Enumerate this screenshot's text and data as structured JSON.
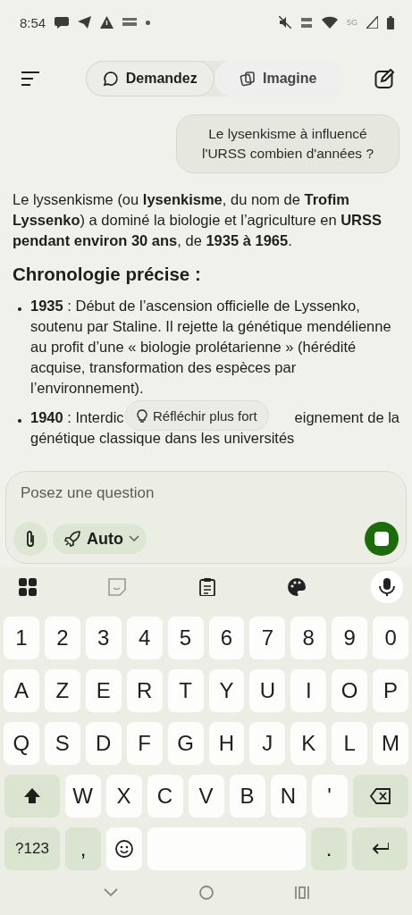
{
  "status_bar": {
    "time": "8:54",
    "network": "5G"
  },
  "header": {
    "tabs": [
      {
        "label": "Demandez",
        "selected": true
      },
      {
        "label": "Imagine",
        "selected": false
      }
    ]
  },
  "user_message": "Le lysenkisme à influencé l'URSS combien d'années ?",
  "answer": {
    "intro": "Le lyssenkisme (ou **lysenkisme**, du nom de **Trofim Lyssenko**) a dominé la biologie et l’agriculture en **URSS pendant environ 30 ans**, de **1935 à 1965**.",
    "heading": "Chronologie précise :",
    "bullets": [
      {
        "text": "**1935** : Début de l’ascension officielle de Lyssenko, soutenu par Staline. Il rejette la génétique mendélienne au profit d’une « biologie prolétarienne » (hérédité acquise, transformation des espèces par l’environnement)."
      },
      {
        "before": "**1940** : Interdic",
        "after": "eignement de la",
        "continuation": "génétique classique dans les universités"
      }
    ],
    "think_button": "Réfléchir plus fort"
  },
  "composer": {
    "placeholder": "Posez une question",
    "mode": "Auto"
  },
  "keyboard": {
    "rows": [
      [
        {
          "kind": "char",
          "label": "1"
        },
        {
          "kind": "char",
          "label": "2"
        },
        {
          "kind": "char",
          "label": "3"
        },
        {
          "kind": "char",
          "label": "4"
        },
        {
          "kind": "char",
          "label": "5"
        },
        {
          "kind": "char",
          "label": "6"
        },
        {
          "kind": "char",
          "label": "7"
        },
        {
          "kind": "char",
          "label": "8"
        },
        {
          "kind": "char",
          "label": "9"
        },
        {
          "kind": "char",
          "label": "0"
        }
      ],
      [
        {
          "kind": "char",
          "label": "A"
        },
        {
          "kind": "char",
          "label": "Z"
        },
        {
          "kind": "char",
          "label": "E"
        },
        {
          "kind": "char",
          "label": "R"
        },
        {
          "kind": "char",
          "label": "T"
        },
        {
          "kind": "char",
          "label": "Y"
        },
        {
          "kind": "char",
          "label": "U"
        },
        {
          "kind": "char",
          "label": "I"
        },
        {
          "kind": "char",
          "label": "O"
        },
        {
          "kind": "char",
          "label": "P"
        }
      ],
      [
        {
          "kind": "char",
          "label": "Q"
        },
        {
          "kind": "char",
          "label": "S"
        },
        {
          "kind": "char",
          "label": "D"
        },
        {
          "kind": "char",
          "label": "F"
        },
        {
          "kind": "char",
          "label": "G"
        },
        {
          "kind": "char",
          "label": "H"
        },
        {
          "kind": "char",
          "label": "J"
        },
        {
          "kind": "char",
          "label": "K"
        },
        {
          "kind": "char",
          "label": "L"
        },
        {
          "kind": "char",
          "label": "M"
        }
      ],
      [
        {
          "kind": "shift"
        },
        {
          "kind": "char",
          "label": "W"
        },
        {
          "kind": "char",
          "label": "X"
        },
        {
          "kind": "char",
          "label": "C"
        },
        {
          "kind": "char",
          "label": "V"
        },
        {
          "kind": "char",
          "label": "B"
        },
        {
          "kind": "char",
          "label": "N"
        },
        {
          "kind": "char",
          "label": "'"
        },
        {
          "kind": "backspace"
        }
      ],
      [
        {
          "kind": "mode",
          "label": "?123"
        },
        {
          "kind": "punct",
          "label": ","
        },
        {
          "kind": "emoji"
        },
        {
          "kind": "space"
        },
        {
          "kind": "punct",
          "label": "."
        },
        {
          "kind": "enter"
        }
      ]
    ]
  }
}
